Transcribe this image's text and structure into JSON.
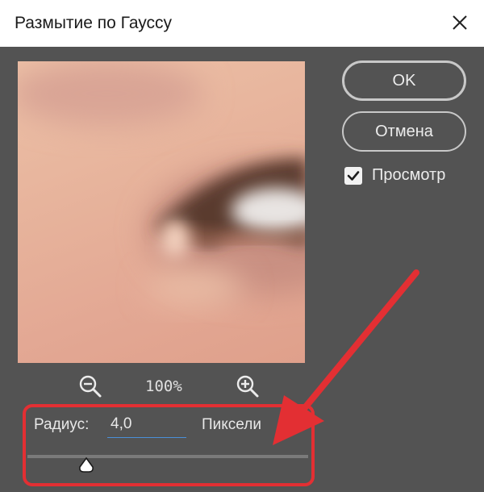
{
  "window": {
    "title": "Размытие по Гауссу"
  },
  "buttons": {
    "ok": "OK",
    "cancel": "Отмена"
  },
  "preview_checkbox": {
    "label": "Просмотр",
    "checked": true
  },
  "zoom": {
    "level": "100%"
  },
  "radius": {
    "label": "Радиус:",
    "value": "4,0",
    "unit": "Пиксели",
    "slider_fraction": 0.2
  },
  "icons": [
    "close-icon",
    "zoom-out-icon",
    "zoom-in-icon",
    "checkmark-icon",
    "slider-thumb"
  ],
  "colors": {
    "annotation": "#e32f33",
    "dialog_bg": "#535353",
    "input_underline": "#4a90d9"
  }
}
